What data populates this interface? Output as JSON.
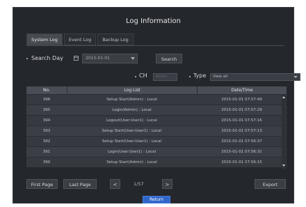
{
  "dialog": {
    "title": "Log Information"
  },
  "tabs": [
    {
      "label": "System Log",
      "active": true
    },
    {
      "label": "Event Log",
      "active": false
    },
    {
      "label": "Backup Log",
      "active": false
    }
  ],
  "search": {
    "label": "Search Day",
    "date_value": "2015-01-01",
    "button_label": "Search"
  },
  "filter": {
    "ch_label": "CH",
    "ch_value": "All Chn",
    "type_label": "Type",
    "type_value": "View all"
  },
  "table": {
    "headers": {
      "no": "No.",
      "log": "Log List",
      "date": "Date/Time"
    },
    "rows": [
      {
        "no": "396",
        "log": "Setup Start(Admin) : Local",
        "date": "2015-01-01 07:57:49"
      },
      {
        "no": "395",
        "log": "Login(Admin) : Local",
        "date": "2015-01-01 07:57:29"
      },
      {
        "no": "394",
        "log": "Logout(User:User1) : Local",
        "date": "2015-01-01 07:57:16"
      },
      {
        "no": "393",
        "log": "Setup Start(User:User1) : Local",
        "date": "2015-01-01 07:57:13"
      },
      {
        "no": "392",
        "log": "Setup Start(User:User1) : Local",
        "date": "2015-01-01 07:56:37"
      },
      {
        "no": "391",
        "log": "Login(User:User1) : Local",
        "date": "2015-01-01 07:56:31"
      },
      {
        "no": "390",
        "log": "Setup Start(Admin) : Local",
        "date": "2015-01-01 07:56:15"
      }
    ]
  },
  "pager": {
    "first_label": "First Page",
    "last_label": "Last Page",
    "prev_label": "<",
    "page_info": "1/57",
    "next_label": ">",
    "export_label": "Export"
  },
  "footer": {
    "return_label": "Return"
  },
  "colors": {
    "background": "#24272c",
    "return_button": "#2f66c9"
  }
}
